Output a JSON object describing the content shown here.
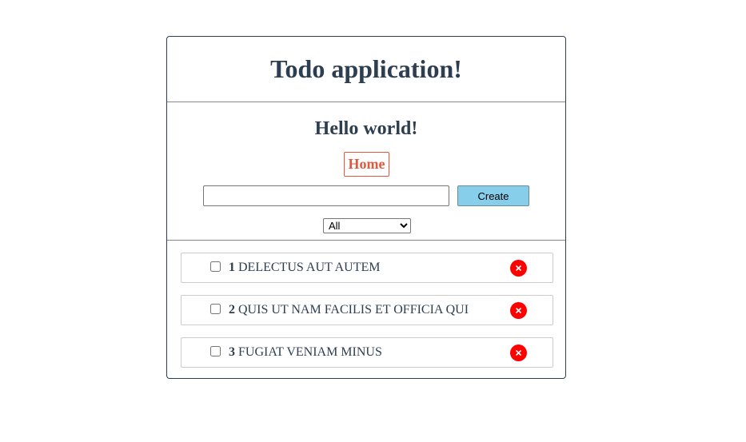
{
  "header": {
    "title": "Todo application!"
  },
  "controls": {
    "greeting": "Hello world!",
    "home_link": "Home",
    "new_todo_value": "",
    "new_todo_placeholder": "",
    "create_label": "Create",
    "filter_selected": "All"
  },
  "todos": [
    {
      "id": "1",
      "title": "DELECTUS AUT AUTEM",
      "completed": false
    },
    {
      "id": "2",
      "title": "QUIS UT NAM FACILIS ET OFFICIA QUI",
      "completed": false
    },
    {
      "id": "3",
      "title": "FUGIAT VENIAM MINUS",
      "completed": false
    }
  ],
  "colors": {
    "text": "#2c3e50",
    "home_accent": "#e2583e",
    "create_button": "#87ceeb",
    "delete_button": "#ff0000"
  },
  "icons": {
    "delete": "close-icon"
  }
}
